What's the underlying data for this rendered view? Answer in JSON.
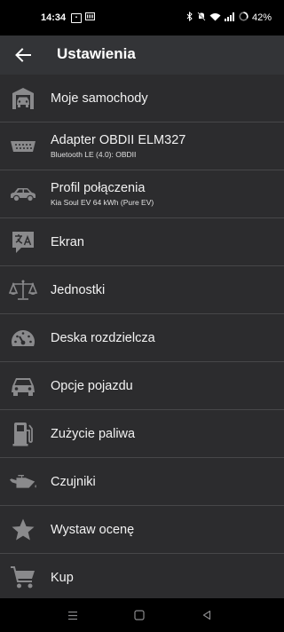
{
  "status_bar": {
    "time": "14:34",
    "battery": "42%",
    "icons": [
      "sim-icon",
      "nfc-icon",
      "bluetooth-icon",
      "mute-icon",
      "wifi-icon",
      "signal-icon",
      "battery-icon"
    ]
  },
  "app_bar": {
    "title": "Ustawienia",
    "back_icon": "arrow-left-icon"
  },
  "settings": [
    {
      "label": "Moje samochody",
      "subtitle": "",
      "icon": "garage-icon"
    },
    {
      "label": "Adapter OBDII ELM327",
      "subtitle": "Bluetooth LE (4.0): OBDII",
      "icon": "obd-connector-icon"
    },
    {
      "label": "Profil połączenia",
      "subtitle": "Kia Soul EV 64 kWh (Pure EV)",
      "icon": "car-side-icon"
    },
    {
      "label": "Ekran",
      "subtitle": "",
      "icon": "translate-icon"
    },
    {
      "label": "Jednostki",
      "subtitle": "",
      "icon": "scale-icon"
    },
    {
      "label": "Deska rozdzielcza",
      "subtitle": "",
      "icon": "speedometer-icon"
    },
    {
      "label": "Opcje pojazdu",
      "subtitle": "",
      "icon": "car-front-icon"
    },
    {
      "label": "Zużycie paliwa",
      "subtitle": "",
      "icon": "fuel-pump-icon"
    },
    {
      "label": "Czujniki",
      "subtitle": "",
      "icon": "oil-can-icon"
    },
    {
      "label": "Wystaw ocenę",
      "subtitle": "",
      "icon": "star-icon"
    },
    {
      "label": "Kup",
      "subtitle": "",
      "icon": "cart-icon"
    }
  ],
  "colors": {
    "app_bar": "#333437",
    "list_background": "#2c2c2e",
    "divider": "#474749",
    "icon": "#8a8a8c"
  }
}
